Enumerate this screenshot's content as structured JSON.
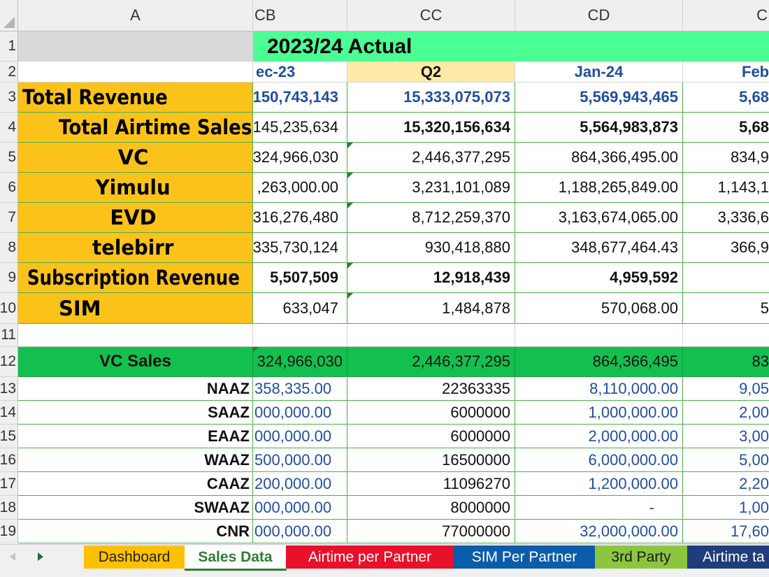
{
  "sheet": {
    "columns": [
      "A",
      "CB",
      "CC",
      "CD",
      "CE"
    ],
    "title": "2023/24 Actual",
    "row_numbers": [
      "1",
      "2",
      "3",
      "4",
      "5",
      "6",
      "7",
      "8",
      "9",
      "10",
      "11",
      "12",
      "13",
      "14",
      "15",
      "16",
      "17",
      "18",
      "19"
    ],
    "period_headers": [
      "ec-23",
      "Q2",
      "Jan-24",
      "Feb"
    ],
    "summary_rows": [
      {
        "label": "Total Revenue",
        "cb": "150,743,143",
        "cc": "15,333,075,073",
        "cd": "5,569,943,465",
        "ce": "5,68"
      },
      {
        "label": "Total Airtime Sales",
        "cb": "145,235,634",
        "cc": "15,320,156,634",
        "cd": "5,564,983,873",
        "ce": "5,68"
      },
      {
        "label": "VC",
        "cb": "324,966,030",
        "cc": "2,446,377,295",
        "cd": "864,366,495.00",
        "ce": "834,9"
      },
      {
        "label": "Yimulu",
        "cb": ",263,000.00",
        "cc": "3,231,101,089",
        "cd": "1,188,265,849.00",
        "ce": "1,143,1"
      },
      {
        "label": "EVD",
        "cb": "316,276,480",
        "cc": "8,712,259,370",
        "cd": "3,163,674,065.00",
        "ce": "3,336,6"
      },
      {
        "label": "telebirr",
        "cb": "335,730,124",
        "cc": "930,418,880",
        "cd": "348,677,464.43",
        "ce": "366,9"
      },
      {
        "label": "Subscription Revenue",
        "cb": "5,507,509",
        "cc": "12,918,439",
        "cd": "4,959,592",
        "ce": ""
      },
      {
        "label": "SIM",
        "cb": "633,047",
        "cc": "1,484,878",
        "cd": "570,068.00",
        "ce": "5"
      }
    ],
    "vc_sales": {
      "label": "VC Sales",
      "cb": "324,966,030",
      "cc": "2,446,377,295",
      "cd": "864,366,495",
      "ce": "83"
    },
    "partner_rows": [
      {
        "label": "NAAZ",
        "cb": "358,335.00",
        "cc": "22363335",
        "cd": "8,110,000.00",
        "ce": "9,05"
      },
      {
        "label": "SAAZ",
        "cb": "000,000.00",
        "cc": "6000000",
        "cd": "1,000,000.00",
        "ce": "2,00"
      },
      {
        "label": "EAAZ",
        "cb": "000,000.00",
        "cc": "6000000",
        "cd": "2,000,000.00",
        "ce": "3,00"
      },
      {
        "label": "WAAZ",
        "cb": "500,000.00",
        "cc": "16500000",
        "cd": "6,000,000.00",
        "ce": "5,00"
      },
      {
        "label": "CAAZ",
        "cb": "200,000.00",
        "cc": "11096270",
        "cd": "1,200,000.00",
        "ce": "2,20"
      },
      {
        "label": "SWAAZ",
        "cb": "000,000.00",
        "cc": "8000000",
        "cd": "-",
        "ce": "1,00"
      },
      {
        "label": "CNR",
        "cb": "000,000.00",
        "cc": "77000000",
        "cd": "32,000,000.00",
        "ce": "17,60"
      }
    ]
  },
  "tabs": [
    {
      "label": "Dashboard",
      "color": "#ffc000",
      "text_color": "#222"
    },
    {
      "label": "Sales Data",
      "color": "#ffffff",
      "text_color": "#2e7d32"
    },
    {
      "label": "Airtime per Partner",
      "color": "#e8102a",
      "text_color": "#ffffff"
    },
    {
      "label": "SIM Per Partner",
      "color": "#0b5cab",
      "text_color": "#ffffff"
    },
    {
      "label": "3rd Party",
      "color": "#8cc63f",
      "text_color": "#1a1a1a"
    },
    {
      "label": "Airtime ta",
      "color": "#1f3d7a",
      "text_color": "#ffffff"
    }
  ],
  "nav": {
    "prev_icon": "triangle-left-icon",
    "next_icon": "triangle-right-icon"
  },
  "colors": {
    "title_fill": "#4cff94",
    "vc_sales_fill": "#13c04f",
    "label_fill": "#fbc31a",
    "q2_fill": "#ffe9a6"
  }
}
